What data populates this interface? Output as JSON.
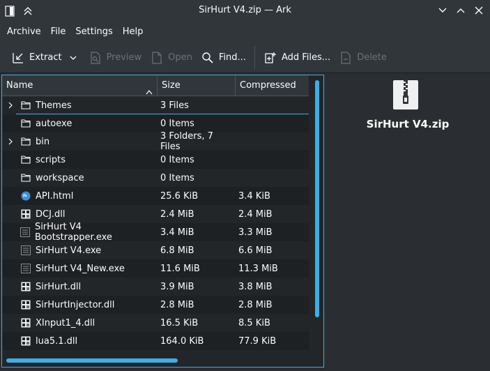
{
  "window": {
    "title": "SirHurt V4.zip — Ark"
  },
  "menu": {
    "items": [
      "Archive",
      "File",
      "Settings",
      "Help"
    ]
  },
  "toolbar": {
    "extract": "Extract",
    "preview": "Preview",
    "open": "Open",
    "find": "Find...",
    "add_files": "Add Files...",
    "delete": "Delete"
  },
  "columns": {
    "name": "Name",
    "size": "Size",
    "compressed": "Compressed"
  },
  "files": [
    {
      "name": "Themes",
      "size": "3 Files",
      "compressed": "",
      "type": "folder",
      "expandable": true
    },
    {
      "name": "autoexe",
      "size": "0 Items",
      "compressed": "",
      "type": "folder",
      "expandable": false
    },
    {
      "name": "bin",
      "size": "3 Folders, 7 Files",
      "compressed": "",
      "type": "folder",
      "expandable": true
    },
    {
      "name": "scripts",
      "size": "0 Items",
      "compressed": "",
      "type": "folder",
      "expandable": false
    },
    {
      "name": "workspace",
      "size": "0 Items",
      "compressed": "",
      "type": "folder",
      "expandable": false
    },
    {
      "name": "API.html",
      "size": "25.6 KiB",
      "compressed": "3.4 KiB",
      "type": "html",
      "expandable": false
    },
    {
      "name": "DCJ.dll",
      "size": "2.4 MiB",
      "compressed": "2.4 MiB",
      "type": "dll",
      "expandable": false
    },
    {
      "name": "SirHurt V4 Bootstrapper.exe",
      "size": "3.4 MiB",
      "compressed": "3.3 MiB",
      "type": "exe",
      "expandable": false
    },
    {
      "name": "SirHurt V4.exe",
      "size": "6.8 MiB",
      "compressed": "6.6 MiB",
      "type": "exe",
      "expandable": false
    },
    {
      "name": "SirHurt V4_New.exe",
      "size": "11.6 MiB",
      "compressed": "11.3 MiB",
      "type": "exe",
      "expandable": false
    },
    {
      "name": "SirHurt.dll",
      "size": "3.9 MiB",
      "compressed": "3.8 MiB",
      "type": "dll",
      "expandable": false
    },
    {
      "name": "SirHurtInjector.dll",
      "size": "2.8 MiB",
      "compressed": "2.8 MiB",
      "type": "dll",
      "expandable": false
    },
    {
      "name": "XInput1_4.dll",
      "size": "16.5 KiB",
      "compressed": "8.5 KiB",
      "type": "dll",
      "expandable": false
    },
    {
      "name": "lua5.1.dll",
      "size": "164.0 KiB",
      "compressed": "77.9 KiB",
      "type": "dll",
      "expandable": false
    }
  ],
  "preview": {
    "filename": "SirHurt V4.zip"
  },
  "colors": {
    "accent": "#3daee9",
    "window_bg": "#31363b",
    "view_bg": "#232629",
    "alt_row": "#1e2124",
    "text": "#fcfcfc",
    "disabled_text": "#6e7276"
  }
}
